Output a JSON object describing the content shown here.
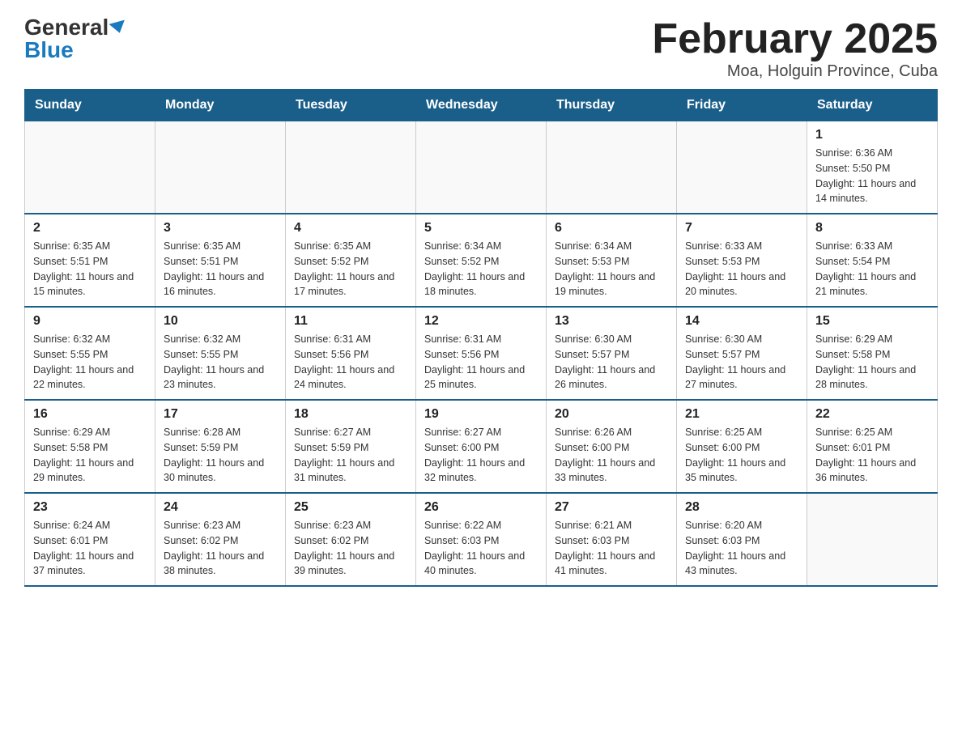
{
  "logo": {
    "general": "General",
    "blue": "Blue"
  },
  "title": "February 2025",
  "subtitle": "Moa, Holguin Province, Cuba",
  "days_header": [
    "Sunday",
    "Monday",
    "Tuesday",
    "Wednesday",
    "Thursday",
    "Friday",
    "Saturday"
  ],
  "weeks": [
    [
      {
        "day": "",
        "sunrise": "",
        "sunset": "",
        "daylight": ""
      },
      {
        "day": "",
        "sunrise": "",
        "sunset": "",
        "daylight": ""
      },
      {
        "day": "",
        "sunrise": "",
        "sunset": "",
        "daylight": ""
      },
      {
        "day": "",
        "sunrise": "",
        "sunset": "",
        "daylight": ""
      },
      {
        "day": "",
        "sunrise": "",
        "sunset": "",
        "daylight": ""
      },
      {
        "day": "",
        "sunrise": "",
        "sunset": "",
        "daylight": ""
      },
      {
        "day": "1",
        "sunrise": "Sunrise: 6:36 AM",
        "sunset": "Sunset: 5:50 PM",
        "daylight": "Daylight: 11 hours and 14 minutes."
      }
    ],
    [
      {
        "day": "2",
        "sunrise": "Sunrise: 6:35 AM",
        "sunset": "Sunset: 5:51 PM",
        "daylight": "Daylight: 11 hours and 15 minutes."
      },
      {
        "day": "3",
        "sunrise": "Sunrise: 6:35 AM",
        "sunset": "Sunset: 5:51 PM",
        "daylight": "Daylight: 11 hours and 16 minutes."
      },
      {
        "day": "4",
        "sunrise": "Sunrise: 6:35 AM",
        "sunset": "Sunset: 5:52 PM",
        "daylight": "Daylight: 11 hours and 17 minutes."
      },
      {
        "day": "5",
        "sunrise": "Sunrise: 6:34 AM",
        "sunset": "Sunset: 5:52 PM",
        "daylight": "Daylight: 11 hours and 18 minutes."
      },
      {
        "day": "6",
        "sunrise": "Sunrise: 6:34 AM",
        "sunset": "Sunset: 5:53 PM",
        "daylight": "Daylight: 11 hours and 19 minutes."
      },
      {
        "day": "7",
        "sunrise": "Sunrise: 6:33 AM",
        "sunset": "Sunset: 5:53 PM",
        "daylight": "Daylight: 11 hours and 20 minutes."
      },
      {
        "day": "8",
        "sunrise": "Sunrise: 6:33 AM",
        "sunset": "Sunset: 5:54 PM",
        "daylight": "Daylight: 11 hours and 21 minutes."
      }
    ],
    [
      {
        "day": "9",
        "sunrise": "Sunrise: 6:32 AM",
        "sunset": "Sunset: 5:55 PM",
        "daylight": "Daylight: 11 hours and 22 minutes."
      },
      {
        "day": "10",
        "sunrise": "Sunrise: 6:32 AM",
        "sunset": "Sunset: 5:55 PM",
        "daylight": "Daylight: 11 hours and 23 minutes."
      },
      {
        "day": "11",
        "sunrise": "Sunrise: 6:31 AM",
        "sunset": "Sunset: 5:56 PM",
        "daylight": "Daylight: 11 hours and 24 minutes."
      },
      {
        "day": "12",
        "sunrise": "Sunrise: 6:31 AM",
        "sunset": "Sunset: 5:56 PM",
        "daylight": "Daylight: 11 hours and 25 minutes."
      },
      {
        "day": "13",
        "sunrise": "Sunrise: 6:30 AM",
        "sunset": "Sunset: 5:57 PM",
        "daylight": "Daylight: 11 hours and 26 minutes."
      },
      {
        "day": "14",
        "sunrise": "Sunrise: 6:30 AM",
        "sunset": "Sunset: 5:57 PM",
        "daylight": "Daylight: 11 hours and 27 minutes."
      },
      {
        "day": "15",
        "sunrise": "Sunrise: 6:29 AM",
        "sunset": "Sunset: 5:58 PM",
        "daylight": "Daylight: 11 hours and 28 minutes."
      }
    ],
    [
      {
        "day": "16",
        "sunrise": "Sunrise: 6:29 AM",
        "sunset": "Sunset: 5:58 PM",
        "daylight": "Daylight: 11 hours and 29 minutes."
      },
      {
        "day": "17",
        "sunrise": "Sunrise: 6:28 AM",
        "sunset": "Sunset: 5:59 PM",
        "daylight": "Daylight: 11 hours and 30 minutes."
      },
      {
        "day": "18",
        "sunrise": "Sunrise: 6:27 AM",
        "sunset": "Sunset: 5:59 PM",
        "daylight": "Daylight: 11 hours and 31 minutes."
      },
      {
        "day": "19",
        "sunrise": "Sunrise: 6:27 AM",
        "sunset": "Sunset: 6:00 PM",
        "daylight": "Daylight: 11 hours and 32 minutes."
      },
      {
        "day": "20",
        "sunrise": "Sunrise: 6:26 AM",
        "sunset": "Sunset: 6:00 PM",
        "daylight": "Daylight: 11 hours and 33 minutes."
      },
      {
        "day": "21",
        "sunrise": "Sunrise: 6:25 AM",
        "sunset": "Sunset: 6:00 PM",
        "daylight": "Daylight: 11 hours and 35 minutes."
      },
      {
        "day": "22",
        "sunrise": "Sunrise: 6:25 AM",
        "sunset": "Sunset: 6:01 PM",
        "daylight": "Daylight: 11 hours and 36 minutes."
      }
    ],
    [
      {
        "day": "23",
        "sunrise": "Sunrise: 6:24 AM",
        "sunset": "Sunset: 6:01 PM",
        "daylight": "Daylight: 11 hours and 37 minutes."
      },
      {
        "day": "24",
        "sunrise": "Sunrise: 6:23 AM",
        "sunset": "Sunset: 6:02 PM",
        "daylight": "Daylight: 11 hours and 38 minutes."
      },
      {
        "day": "25",
        "sunrise": "Sunrise: 6:23 AM",
        "sunset": "Sunset: 6:02 PM",
        "daylight": "Daylight: 11 hours and 39 minutes."
      },
      {
        "day": "26",
        "sunrise": "Sunrise: 6:22 AM",
        "sunset": "Sunset: 6:03 PM",
        "daylight": "Daylight: 11 hours and 40 minutes."
      },
      {
        "day": "27",
        "sunrise": "Sunrise: 6:21 AM",
        "sunset": "Sunset: 6:03 PM",
        "daylight": "Daylight: 11 hours and 41 minutes."
      },
      {
        "day": "28",
        "sunrise": "Sunrise: 6:20 AM",
        "sunset": "Sunset: 6:03 PM",
        "daylight": "Daylight: 11 hours and 43 minutes."
      },
      {
        "day": "",
        "sunrise": "",
        "sunset": "",
        "daylight": ""
      }
    ]
  ]
}
